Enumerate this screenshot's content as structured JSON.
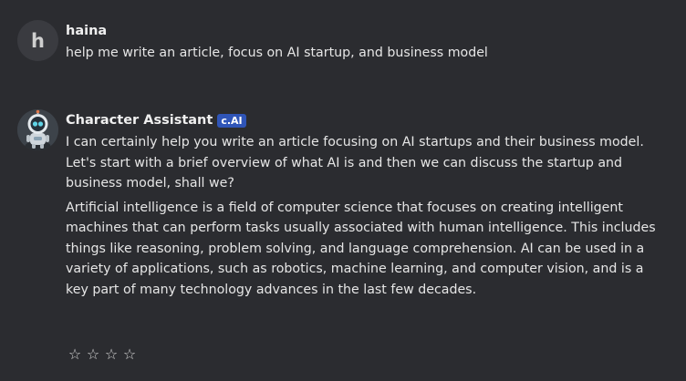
{
  "user_message": {
    "avatar_letter": "h",
    "author": "haina",
    "text": "help me write an article,  focus on AI startup, and business model"
  },
  "bot_message": {
    "author": "Character Assistant",
    "badge": "c.AI",
    "paragraph_1": "I can certainly help you write an article focusing on AI startups and their business model. Let's start with a brief overview of what AI is and then we can discuss the startup and business model, shall we?",
    "paragraph_2": "Artificial intelligence is a field of computer science that focuses on creating intelligent machines that can perform tasks usually associated with human intelligence. This includes things like reasoning, problem solving, and language comprehension. AI can be used in a variety of applications, such as robotics, machine learning, and computer vision, and is a key part of many technology advances in the last few decades."
  },
  "rating": {
    "star_glyph": "☆",
    "stars": 4
  },
  "colors": {
    "background": "#2b2c30",
    "badge": "#2f55b8",
    "text": "#e6e6e6"
  }
}
